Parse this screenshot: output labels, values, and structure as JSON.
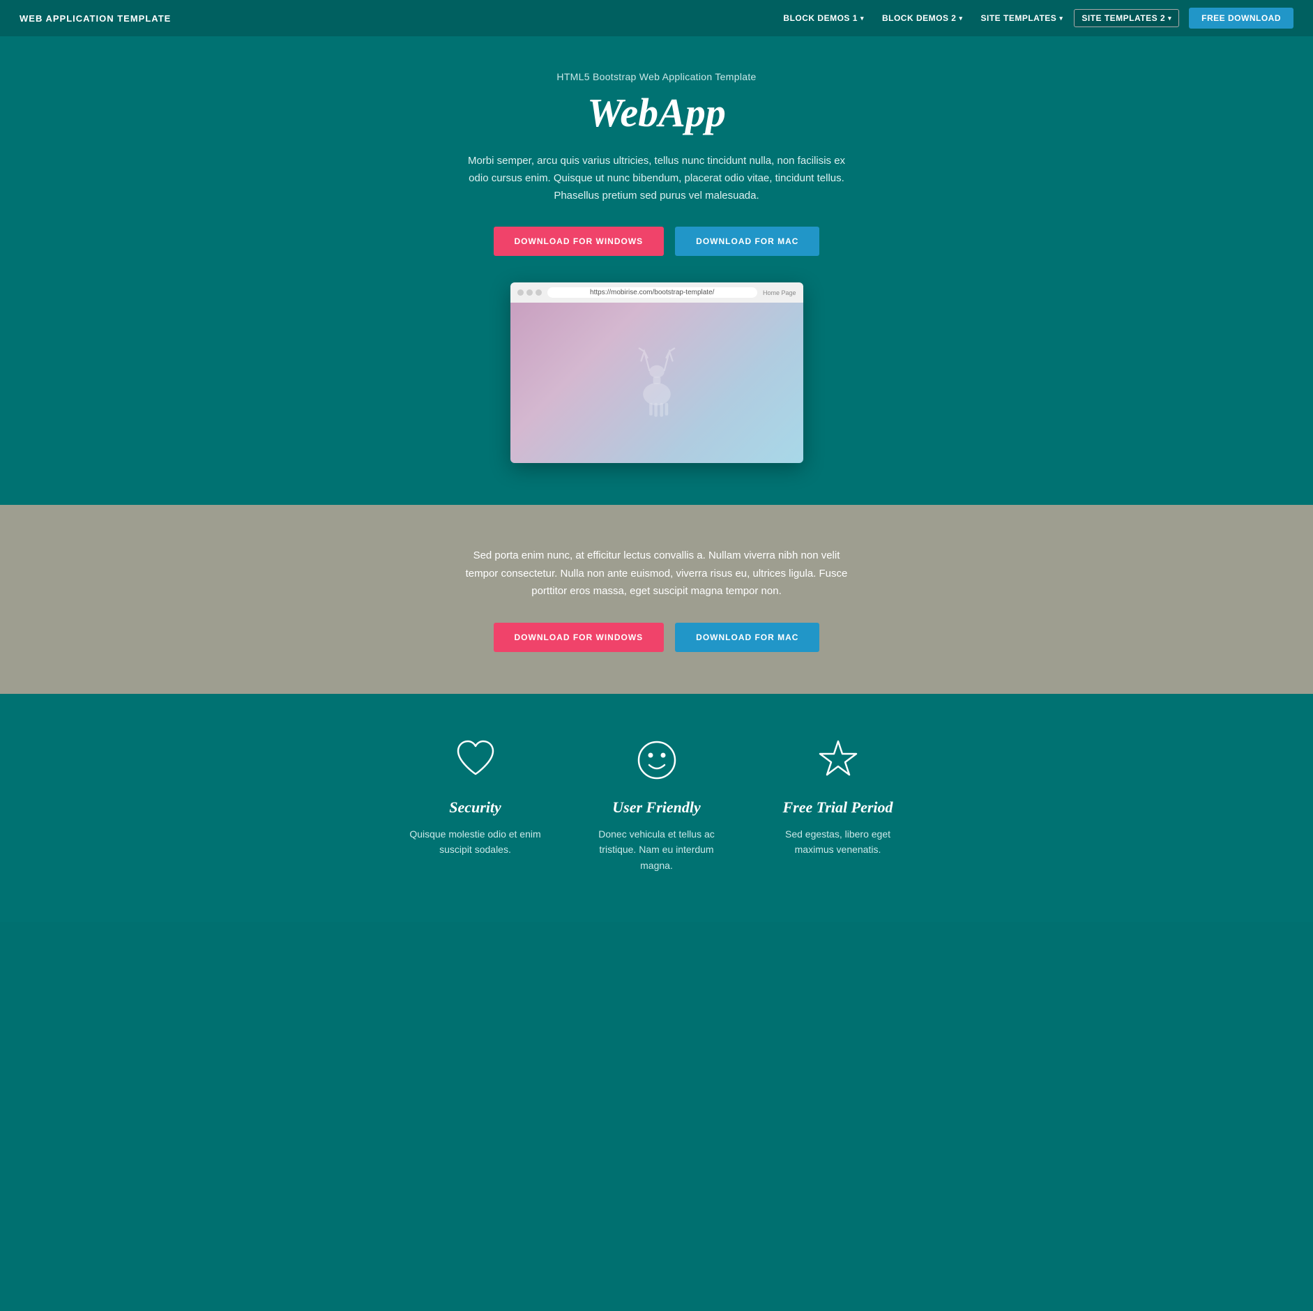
{
  "nav": {
    "brand": "WEB APPLICATION TEMPLATE",
    "links": [
      {
        "label": "BLOCK DEMOS 1",
        "has_caret": true
      },
      {
        "label": "BLOCK DEMOS 2",
        "has_caret": true
      },
      {
        "label": "SITE TEMPLATES",
        "has_caret": true
      },
      {
        "label": "SITE TEMPLATES 2",
        "active": true,
        "has_caret": true
      }
    ],
    "cta": "FREE DOWNLOAD"
  },
  "hero": {
    "subtitle": "HTML5 Bootstrap Web Application Template",
    "title": "WebApp",
    "description": "Morbi semper, arcu quis varius ultricies, tellus nunc tincidunt nulla, non facilisis ex odio cursus enim. Quisque ut nunc bibendum, placerat odio vitae, tincidunt tellus. Phasellus pretium sed purus vel malesuada.",
    "btn_windows": "DOWNLOAD FOR WINDOWS",
    "btn_mac": "DOWNLOAD FOR MAC",
    "browser_url": "https://mobirise.com/bootstrap-template/",
    "browser_home": "Home Page"
  },
  "grey_section": {
    "description": "Sed porta enim nunc, at efficitur lectus convallis a. Nullam viverra nibh non velit tempor consectetur. Nulla non ante euismod, viverra risus eu, ultrices ligula. Fusce porttitor eros massa, eget suscipit magna tempor non.",
    "btn_windows": "DOWNLOAD FOR WINDOWS",
    "btn_mac": "DOWNLOAD FOR MAC"
  },
  "features": {
    "items": [
      {
        "icon": "heart",
        "title": "Security",
        "description": "Quisque molestie odio et enim suscipit sodales."
      },
      {
        "icon": "smiley",
        "title": "User Friendly",
        "description": "Donec vehicula et tellus ac tristique. Nam eu interdum magna."
      },
      {
        "icon": "star",
        "title": "Free Trial Period",
        "description": "Sed egestas, libero eget maximus venenatis."
      }
    ]
  }
}
